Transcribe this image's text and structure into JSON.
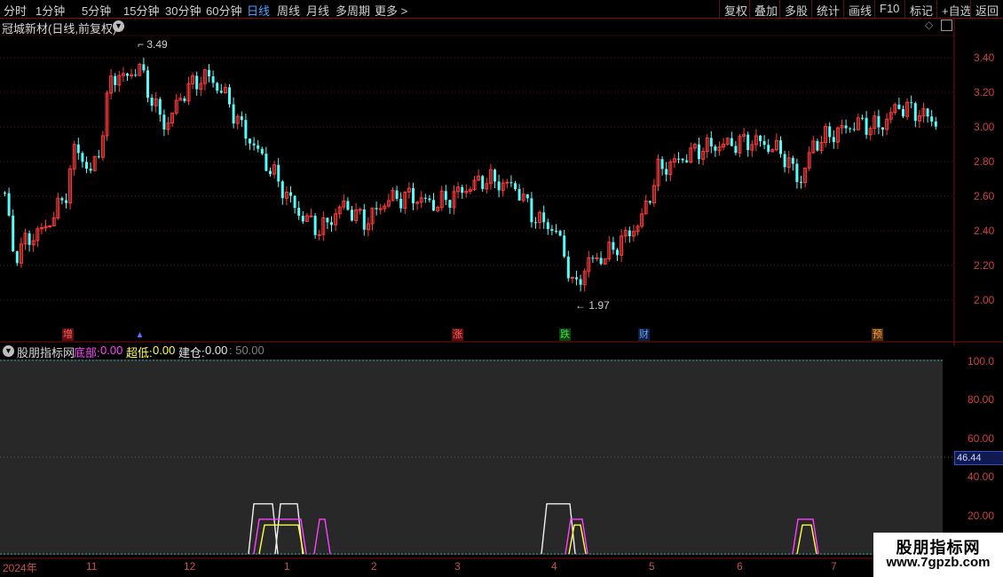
{
  "toolbar": {
    "periods": [
      "分时",
      "1分钟",
      "5分钟",
      "15分钟",
      "30分钟",
      "60分钟",
      "日线",
      "周线",
      "月线",
      "多周期",
      "更多 >"
    ],
    "active": "日线",
    "right": [
      "复权",
      "叠加",
      "多股",
      "统计",
      "画线",
      "F10",
      "标记",
      "+自选",
      "返回"
    ]
  },
  "main": {
    "title": "冠城新材(日线,前复权)",
    "price_labels": [
      "3.40",
      "3.20",
      "3.00",
      "2.80",
      "2.60",
      "2.40",
      "2.20",
      "2.00"
    ],
    "high_marker": "3.49",
    "low_marker": "1.97",
    "event_tags": [
      {
        "text": "增",
        "color": "#d03030"
      },
      {
        "text": "▲",
        "color": "#4060ff"
      },
      {
        "text": "涨",
        "color": "#d03030"
      },
      {
        "text": "跌",
        "color": "#20a020"
      },
      {
        "text": "财",
        "color": "#3070d0"
      },
      {
        "text": "预",
        "color": "#d07020"
      }
    ],
    "colors": {
      "up": "#ff3c3c",
      "down": "#54fcfc",
      "grid": "#7a1010"
    }
  },
  "indicator": {
    "name": "股朋指标网",
    "fields": [
      {
        "label": "底部:",
        "value": "0.00",
        "color": "#ff40ff"
      },
      {
        "label": "超低:",
        "value": "0.00",
        "color": "#ffff40"
      },
      {
        "label": "建仓:",
        "value": "0.00",
        "color": "#e8e8e8"
      }
    ],
    "extra": ": 50.00",
    "y_labels": [
      "100.0",
      "80.00",
      "60.00",
      "40.00",
      "20.00"
    ],
    "current_value": "46.44"
  },
  "date_axis": [
    "2024年",
    "11",
    "12",
    "1",
    "2",
    "3",
    "4",
    "5",
    "6",
    "7"
  ],
  "watermark": {
    "line1": "股朋指标网",
    "line2": "www.7gpzb.com"
  }
}
